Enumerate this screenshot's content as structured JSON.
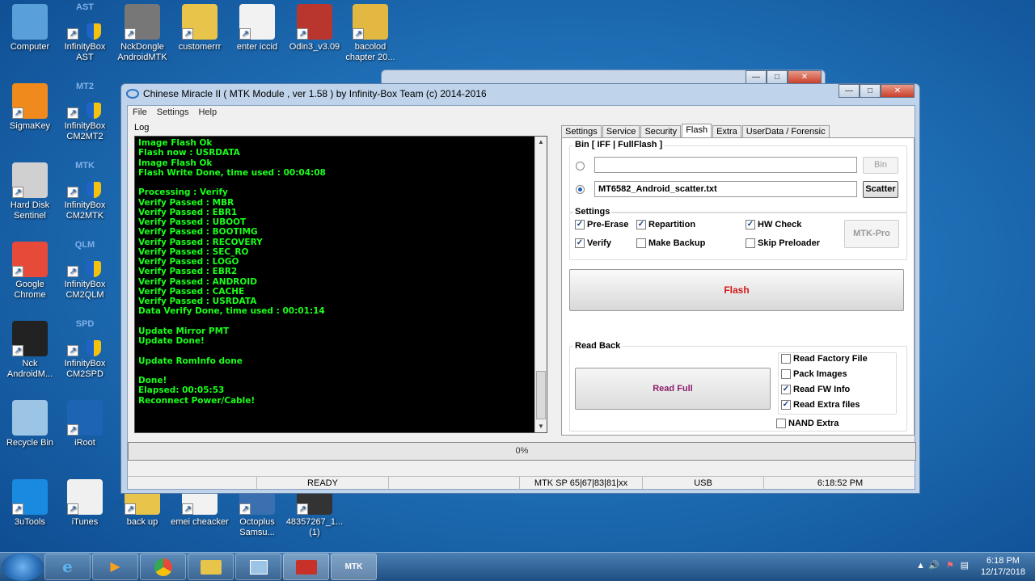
{
  "desktop": {
    "icons": [
      {
        "id": "computer",
        "label": "Computer",
        "tag": "",
        "color": "#5aa0d8"
      },
      {
        "id": "infinitybox-ast",
        "label": "InfinityBox AST",
        "tag": "AST",
        "color": "#3a6fb0"
      },
      {
        "id": "nckdongle",
        "label": "NckDongle AndroidMTK",
        "tag": "",
        "color": "#777"
      },
      {
        "id": "customerrr",
        "label": "customerrr",
        "tag": "",
        "color": "#e8c44a"
      },
      {
        "id": "enter-iccid",
        "label": "enter iccid",
        "tag": "",
        "color": "#f2f2f2"
      },
      {
        "id": "odin3",
        "label": "Odin3_v3.09",
        "tag": "",
        "color": "#b8362e"
      },
      {
        "id": "bacolod",
        "label": "bacolod chapter 20...",
        "tag": "",
        "color": "#e2b742"
      },
      {
        "id": "sigmakey",
        "label": "SigmaKey",
        "tag": "",
        "color": "#f08a1c"
      },
      {
        "id": "infinitybox-cm2mt2",
        "label": "InfinityBox CM2MT2",
        "tag": "MT2",
        "color": "#3a6fb0"
      },
      {
        "id": "hard-disk-sentinel",
        "label": "Hard Disk Sentinel",
        "tag": "",
        "color": "#d0d0d0"
      },
      {
        "id": "infinitybox-cm2mtk",
        "label": "InfinityBox CM2MTK",
        "tag": "MTK",
        "color": "#3a6fb0"
      },
      {
        "id": "google-chrome",
        "label": "Google Chrome",
        "tag": "",
        "color": "#e84a3a"
      },
      {
        "id": "infinitybox-cm2qlm",
        "label": "InfinityBox CM2QLM",
        "tag": "QLM",
        "color": "#3a6fb0"
      },
      {
        "id": "nck-androidm",
        "label": "Nck AndroidM...",
        "tag": "",
        "color": "#222"
      },
      {
        "id": "infinitybox-cm2spd",
        "label": "InfinityBox CM2SPD",
        "tag": "SPD",
        "color": "#3a6fb0"
      },
      {
        "id": "recycle-bin",
        "label": "Recycle Bin",
        "tag": "",
        "color": "#9cc4e4"
      },
      {
        "id": "iroot",
        "label": "iRoot",
        "tag": "",
        "color": "#1e64b4"
      },
      {
        "id": "3utools",
        "label": "3uTools",
        "tag": "",
        "color": "#1a8ae0"
      },
      {
        "id": "itunes",
        "label": "iTunes",
        "tag": "",
        "color": "#f0f0f0"
      },
      {
        "id": "back-up",
        "label": "back up",
        "tag": "",
        "color": "#e8c44a"
      },
      {
        "id": "emei-cheacker",
        "label": "emei cheacker",
        "tag": "",
        "color": "#f2f2f2"
      },
      {
        "id": "octoplus",
        "label": "Octoplus Samsu...",
        "tag": "",
        "color": "#3a6fb0"
      },
      {
        "id": "file-48357267",
        "label": "48357267_1... (1)",
        "tag": "",
        "color": "#333"
      }
    ]
  },
  "window": {
    "title": "Chinese Miracle II ( MTK Module , ver 1.58 ) by Infinity-Box Team (c) 2014-2016",
    "min": "—",
    "max": "□",
    "close": "✕",
    "menu": [
      "File",
      "Settings",
      "Help"
    ],
    "log_label": "Log",
    "log_lines": [
      "Image Flash Ok",
      "Flash now : USRDATA",
      "Image Flash Ok",
      "Flash Write Done, time used : 00:04:08",
      "",
      "Processing : Verify",
      "Verify Passed : MBR",
      "Verify Passed : EBR1",
      "Verify Passed : UBOOT",
      "Verify Passed : BOOTIMG",
      "Verify Passed : RECOVERY",
      "Verify Passed : SEC_RO",
      "Verify Passed : LOGO",
      "Verify Passed : EBR2",
      "Verify Passed : ANDROID",
      "Verify Passed : CACHE",
      "Verify Passed : USRDATA",
      "Data Verify Done, time used : 00:01:14",
      "",
      "Update Mirror PMT",
      "Update Done!",
      "",
      "Update RomInfo done",
      "",
      "Done!",
      "Elapsed: 00:05:53",
      "Reconnect Power/Cable!"
    ],
    "tabs": [
      "Settings",
      "Service",
      "Security",
      "Flash",
      "Extra",
      "UserData / Forensic"
    ],
    "active_tab": "Flash",
    "flash": {
      "bin_group": "Bin  [ IFF | FullFlash ]",
      "bin_value": "",
      "bin_button": "Bin",
      "scatter_value": "MT6582_Android_scatter.txt",
      "scatter_button": "Scatter",
      "settings_group": "Settings",
      "pre_erase": "Pre-Erase",
      "repartition": "Repartition",
      "hw_check": "HW Check",
      "verify": "Verify",
      "make_backup": "Make Backup",
      "skip_preloader": "Skip Preloader",
      "mtk_pro": "MTK-Pro",
      "flash_button": "Flash",
      "readback_group": "Read Back",
      "read_full": "Read Full",
      "read_factory": "Read Factory File",
      "pack_images": "Pack Images",
      "read_fw": "Read FW Info",
      "read_extra": "Read Extra files",
      "nand_extra": "NAND Extra"
    },
    "progress": "0%",
    "status": {
      "state": "READY",
      "chip": "MTK SP 65|67|83|81|xx",
      "port": "USB",
      "time": "6:18:52 PM"
    }
  },
  "taskbar": {
    "items": [
      "IE",
      "Media",
      "Chrome",
      "Explorer",
      "Control",
      "Toolbox",
      "MTK"
    ],
    "mtk_label": "MTK",
    "time": "6:18 PM",
    "date": "12/17/2018"
  }
}
